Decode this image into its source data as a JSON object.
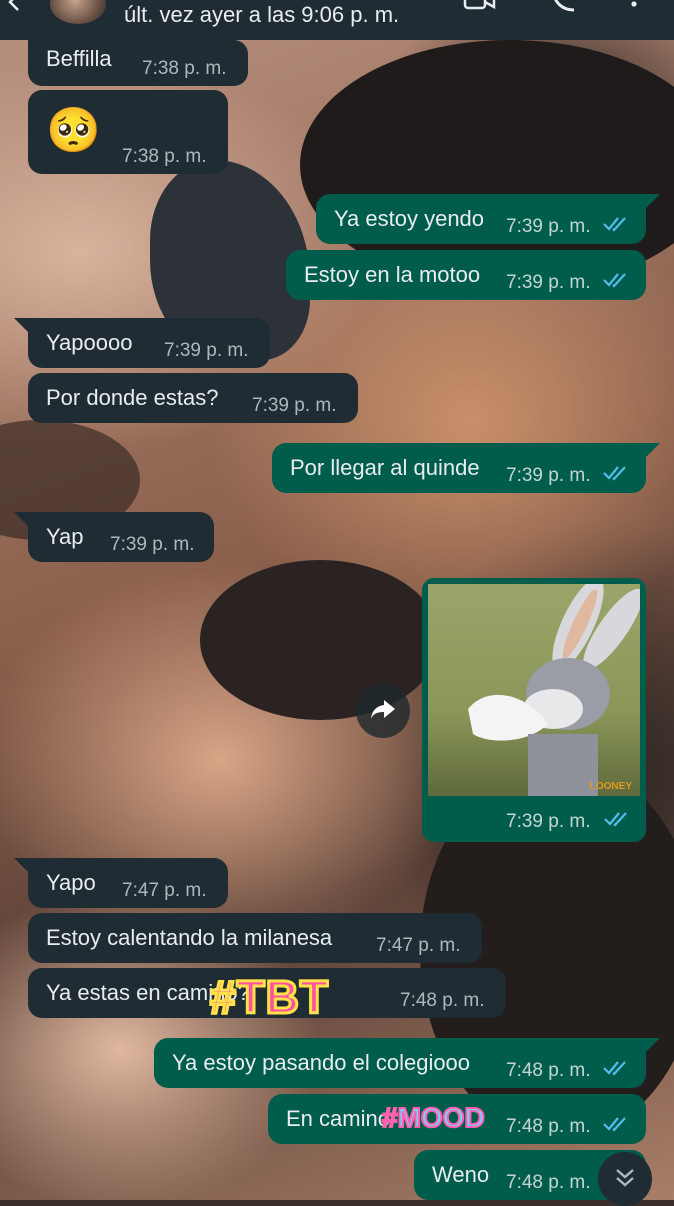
{
  "header": {
    "status": "últ. vez ayer a las 9:06 p. m."
  },
  "messages": [
    {
      "dir": "in",
      "text": "Beffilla",
      "time": "7:38 p. m."
    },
    {
      "dir": "in",
      "text": "🥺",
      "time": "7:38 p. m."
    },
    {
      "dir": "out",
      "text": "Ya estoy yendo",
      "time": "7:39 p. m."
    },
    {
      "dir": "out",
      "text": "Estoy en la motoo",
      "time": "7:39 p. m."
    },
    {
      "dir": "in",
      "text": "Yapoooo",
      "time": "7:39 p. m."
    },
    {
      "dir": "in",
      "text": "Por donde estas?",
      "time": "7:39 p. m."
    },
    {
      "dir": "out",
      "text": "Por llegar al quinde",
      "time": "7:39 p. m."
    },
    {
      "dir": "in",
      "text": "Yap",
      "time": "7:39 p. m."
    },
    {
      "dir": "out",
      "text": "",
      "time": "7:39 p. m.",
      "media": "sticker-image",
      "watermark": "LOONEY"
    },
    {
      "dir": "in",
      "text": "Yapo",
      "time": "7:47 p. m."
    },
    {
      "dir": "in",
      "text": "Estoy calentando la milanesa",
      "time": "7:47 p. m."
    },
    {
      "dir": "in",
      "text": "Ya estas en camino?",
      "time": "7:48 p. m."
    },
    {
      "dir": "out",
      "text": "Ya estoy pasando el colegiooo",
      "time": "7:48 p. m."
    },
    {
      "dir": "out",
      "text": "En camino",
      "time": "7:48 p. m."
    },
    {
      "dir": "out",
      "text": "Weno",
      "time": "7:48 p. m."
    }
  ],
  "overlays": {
    "tbt": "#TBT",
    "mood": "#MOOD"
  },
  "colors": {
    "incoming_bubble": "#1f2c34",
    "outgoing_bubble": "#005c4b",
    "read_tick": "#53bdeb"
  }
}
